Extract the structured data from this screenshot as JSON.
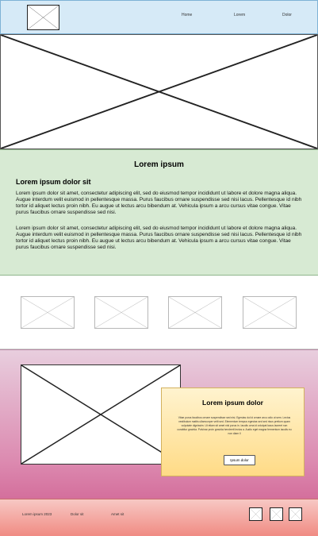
{
  "header": {
    "nav": [
      "Home",
      "Lorem",
      "Dolor"
    ]
  },
  "content": {
    "title": "Lorem ipsum",
    "subtitle": "Lorem ipsum dolor sit",
    "paragraph_1": "Lorem ipsum dolor sit amet, consectetur adipiscing elit, sed do eiusmod tempor incididunt ut labore et dolore magna aliqua. Augue interdum velit euismod in pellentesque massa. Purus faucibus ornare suspendisse sed nisi lacus. Pellentesque id nibh tortor id aliquet lectus proin nibh. Eu augue ut lectus arcu bibendum at. Vehicula ipsum a arcu cursus vitae congue. Vitae purus faucibus ornare suspendisse sed nisi.",
    "paragraph_2": "Lorem ipsum dolor sit amet, consectetur adipiscing elit, sed do eiusmod tempor incididunt ut labore et dolore magna aliqua. Augue interdum velit euismod in pellentesque massa. Purus faucibus ornare suspendisse sed nisi lacus. Pellentesque id nibh tortor id aliquet lectus proin nibh. Eu augue ut lectus arcu bibendum at. Vehicula ipsum a arcu cursus vitae congue. Vitae purus faucibus ornare suspendisse sed nisi."
  },
  "feature": {
    "card_title": "Lorem ipsum dolor",
    "card_text": "Vitae purus faucibus ornare suspendisse sed nisi. Egestas dui id ornare arcu odio ut sem. Lectus vestibulum mattis ullamcorper velit sed. Elementum tempus egestas sed sed risus pretium quam vulputate dignissim. Ut etiam sit amet nisl purus in. Iaculis urna id volutpat lacus laoreet non curabitur gravida. Pulvinar proin gravida hendrerit lectus a. Audio eget magna fermentum iaculis eu non diam ll",
    "button_label": "Ipsum dolor"
  },
  "footer": {
    "copyright": "Lorem ipsum 2023",
    "link_1": "Dolor sit",
    "link_2": "Amet sit"
  },
  "colors": {
    "header_bg": "#d6eaf7",
    "text_section_bg": "#d7ead3",
    "feature_bg_bottom": "#d46f9c",
    "card_bg": "#ffdb86",
    "footer_bg": "#f08b83"
  },
  "icons": {
    "social": [
      "social-icon-1",
      "social-icon-2",
      "social-icon-3"
    ]
  }
}
